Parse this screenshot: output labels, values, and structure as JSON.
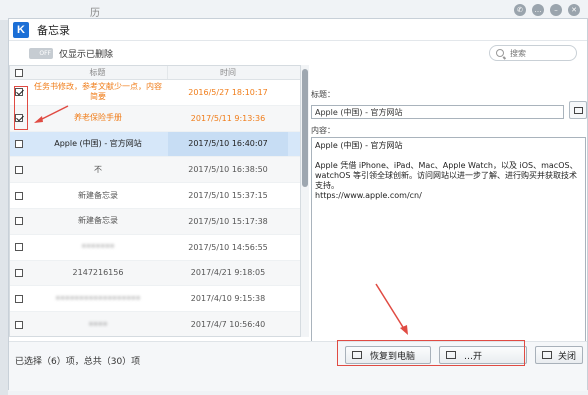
{
  "background_window": {
    "title": "历",
    "tray_icons": [
      "wechat-icon",
      "chat-icon",
      "minimize-icon",
      "close-icon"
    ]
  },
  "dialog": {
    "logo": "K",
    "title": "备忘录"
  },
  "toolbar": {
    "toggle_text": "OFF",
    "toggle_label": "仅显示已删除",
    "search_placeholder": "搜索"
  },
  "list": {
    "col_title": "标题",
    "col_time": "时间",
    "rows": [
      {
        "title": "任务书修改，参考文献少一点，内容简要",
        "time": "2016/5/27 18:10:17",
        "checked": true,
        "orange": true
      },
      {
        "title": "养老保险手册",
        "time": "2017/5/11 9:13:36",
        "checked": true,
        "orange": true
      },
      {
        "title": "Apple (中国) - 官方网站",
        "time": "2017/5/10 16:40:07",
        "checked": false,
        "selected": true
      },
      {
        "title": "不",
        "time": "2017/5/10 16:38:50",
        "checked": false
      },
      {
        "title": "新建备忘录",
        "time": "2017/5/10 15:37:15",
        "checked": false
      },
      {
        "title": "新建备忘录",
        "time": "2017/5/10 15:17:38",
        "checked": false
      },
      {
        "title": "•••••••",
        "time": "2017/5/10 14:56:55",
        "checked": false,
        "blur": true
      },
      {
        "title": "2147216156",
        "time": "2017/4/21 9:18:05",
        "checked": false
      },
      {
        "title": "••••••••••••••••••",
        "time": "2017/4/10 9:15:38",
        "checked": false,
        "blur": true
      },
      {
        "title": "••••",
        "time": "2017/4/7 10:56:40",
        "checked": false,
        "blur": true
      }
    ]
  },
  "detail": {
    "title_label": "标题：",
    "title_value": "Apple (中国) - 官方网站",
    "content_label": "内容：",
    "content_lines": [
      "Apple (中国) - 官方网站",
      "Apple 凭借 iPhone、iPad、Mac、Apple Watch，以及 iOS、macOS、watchOS 等引领全球创新。访问网站以进一步了解、进行购买并获取技术支持。",
      "https://www.apple.com/cn/"
    ]
  },
  "footer": {
    "selection_info": "已选择（6）项，总共（30）项",
    "restore_button": "恢复到电脑",
    "middle_button": "…开",
    "close_button": "关闭"
  },
  "colors": {
    "accent": "#1c6fd6",
    "orange_text": "#f07d1a",
    "annotation_red": "#e04b43",
    "selected_row": "#d6e7f9"
  }
}
